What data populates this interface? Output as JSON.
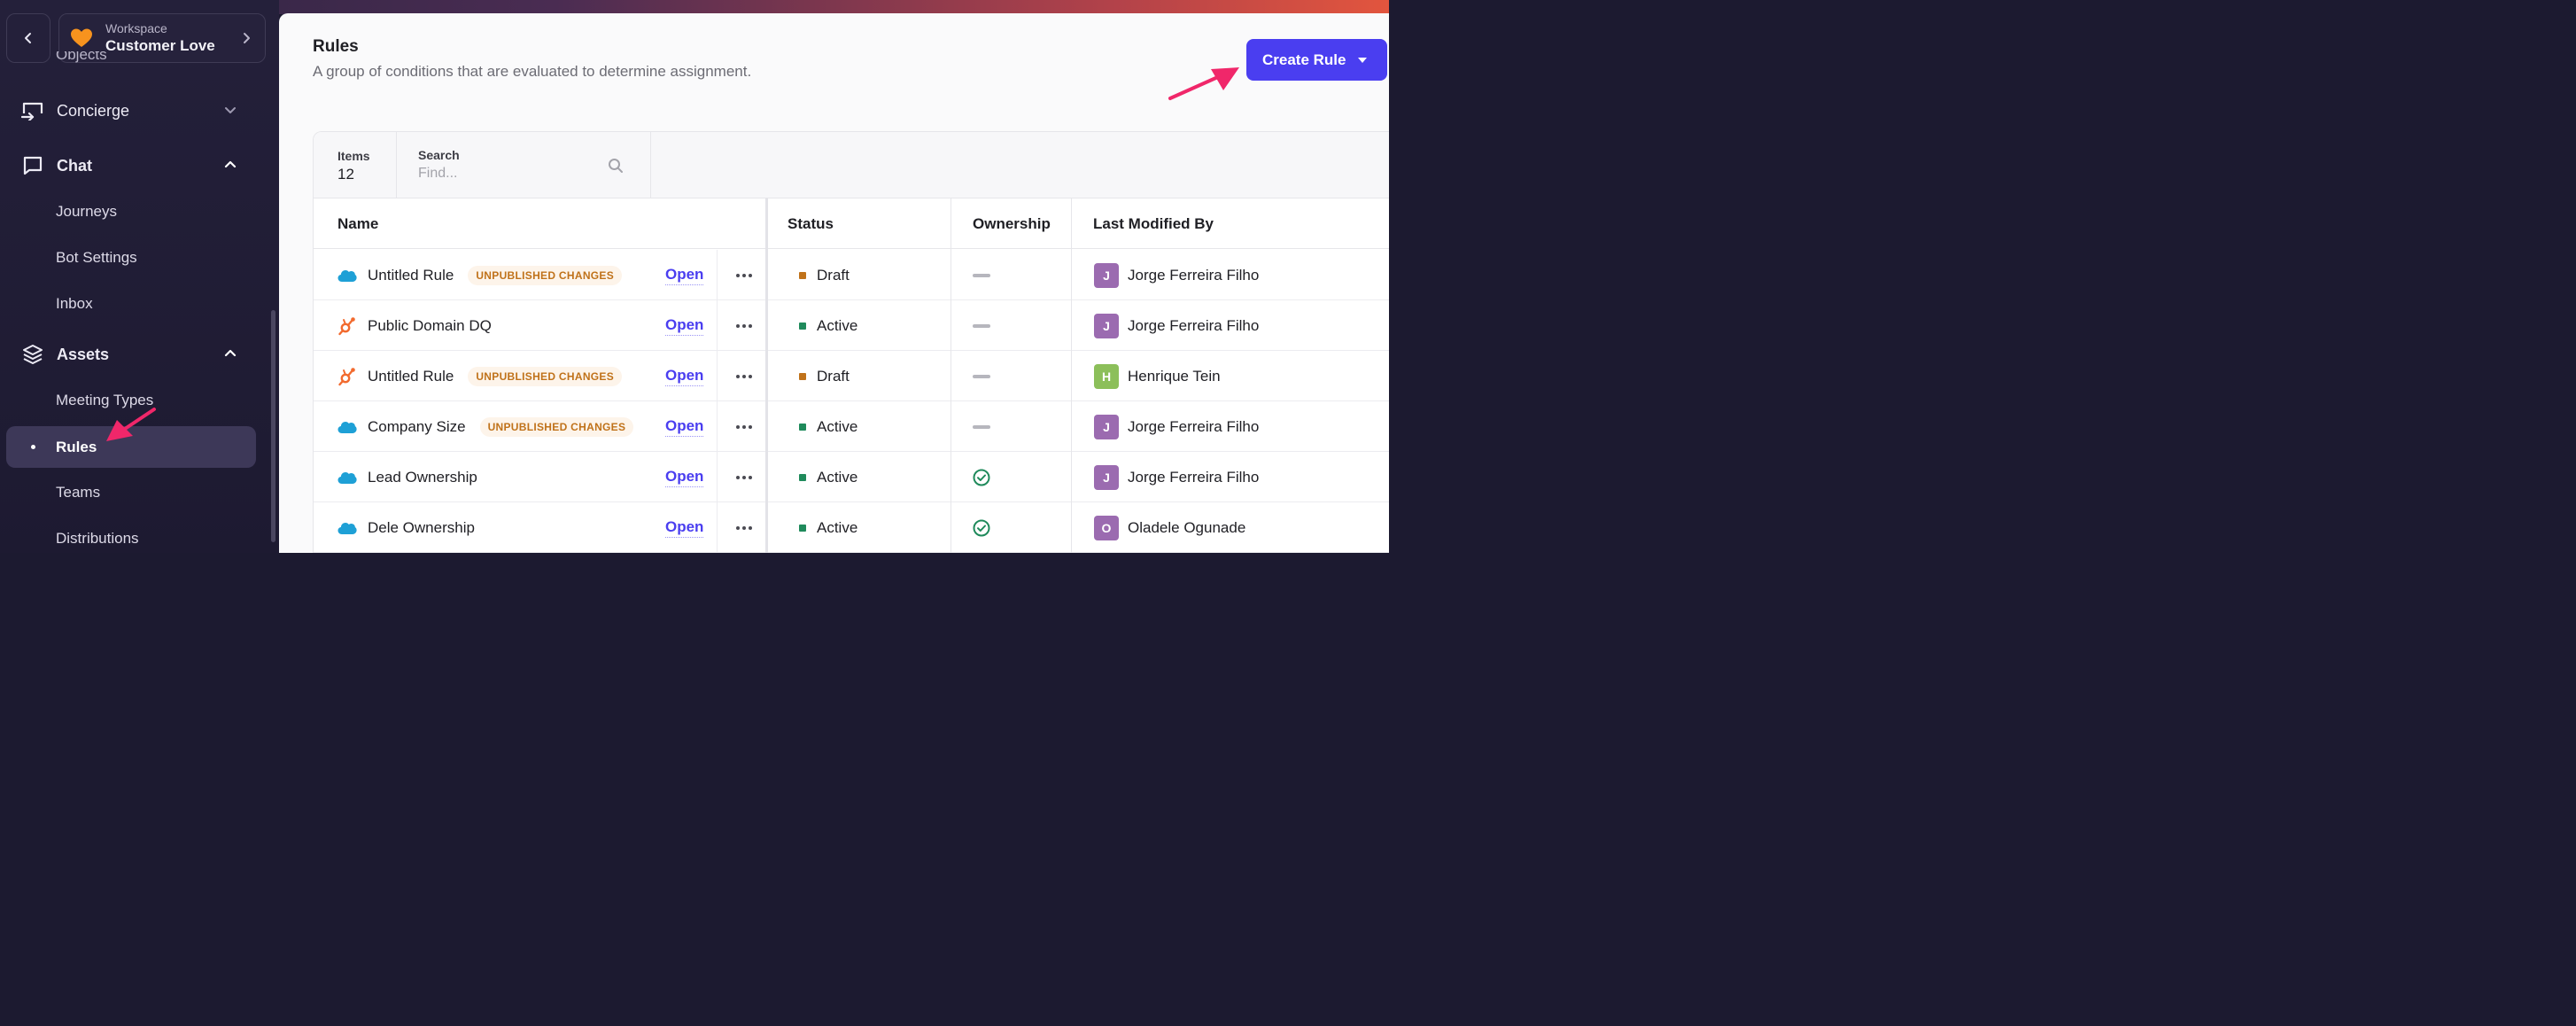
{
  "workspace": {
    "label": "Workspace",
    "name": "Customer Love",
    "icon": "orange-heart-icon"
  },
  "sidebar": {
    "peek_label": "Objects",
    "groups": {
      "concierge": {
        "label": "Concierge",
        "icon": "concierge-icon"
      },
      "chat": {
        "label": "Chat",
        "icon": "chat-bubble-icon"
      },
      "assets": {
        "label": "Assets",
        "icon": "layers-icon"
      }
    },
    "items": {
      "journeys": "Journeys",
      "bot_settings": "Bot Settings",
      "inbox": "Inbox",
      "meeting_types": "Meeting Types",
      "rules": "Rules",
      "teams": "Teams",
      "distributions": "Distributions"
    }
  },
  "page": {
    "title": "Rules",
    "subtitle": "A group of conditions that are evaluated to determine assignment.",
    "create_label": "Create Rule"
  },
  "toolbar": {
    "items_label": "Items",
    "items_count": "12",
    "search_label": "Search",
    "search_placeholder": "Find..."
  },
  "table": {
    "headers": {
      "name": "Name",
      "status": "Status",
      "ownership": "Ownership",
      "last_modified": "Last Modified By"
    },
    "open_label": "Open",
    "rows": [
      {
        "icon": "salesforce-cloud-icon",
        "name": "Untitled Rule",
        "badge": "UNPUBLISHED CHANGES",
        "status": "Draft",
        "status_color": "#c0721a",
        "ownership": "dash",
        "user_initial": "J",
        "user_color": "#9b6bb0",
        "user": "Jorge Ferreira Filho"
      },
      {
        "icon": "hubspot-sprocket-icon",
        "name": "Public Domain DQ",
        "badge": "",
        "status": "Active",
        "status_color": "#1f8a5b",
        "ownership": "dash",
        "user_initial": "J",
        "user_color": "#9b6bb0",
        "user": "Jorge Ferreira Filho"
      },
      {
        "icon": "hubspot-sprocket-icon",
        "name": "Untitled Rule",
        "badge": "UNPUBLISHED CHANGES",
        "status": "Draft",
        "status_color": "#c0721a",
        "ownership": "dash",
        "user_initial": "H",
        "user_color": "#8cbf5a",
        "user": "Henrique Tein"
      },
      {
        "icon": "salesforce-cloud-icon",
        "name": "Company Size",
        "badge": "UNPUBLISHED CHANGES",
        "status": "Active",
        "status_color": "#1f8a5b",
        "ownership": "dash",
        "user_initial": "J",
        "user_color": "#9b6bb0",
        "user": "Jorge Ferreira Filho"
      },
      {
        "icon": "salesforce-cloud-icon",
        "name": "Lead Ownership",
        "badge": "",
        "status": "Active",
        "status_color": "#1f8a5b",
        "ownership": "check",
        "user_initial": "J",
        "user_color": "#9b6bb0",
        "user": "Jorge Ferreira Filho"
      },
      {
        "icon": "salesforce-cloud-icon",
        "name": "Dele Ownership",
        "badge": "",
        "status": "Active",
        "status_color": "#1f8a5b",
        "ownership": "check",
        "user_initial": "O",
        "user_color": "#9b6bb0",
        "user": "Oladele Ogunade"
      }
    ]
  },
  "colors": {
    "accent": "#4a3ef0",
    "annotation_arrow": "#f0276a"
  }
}
